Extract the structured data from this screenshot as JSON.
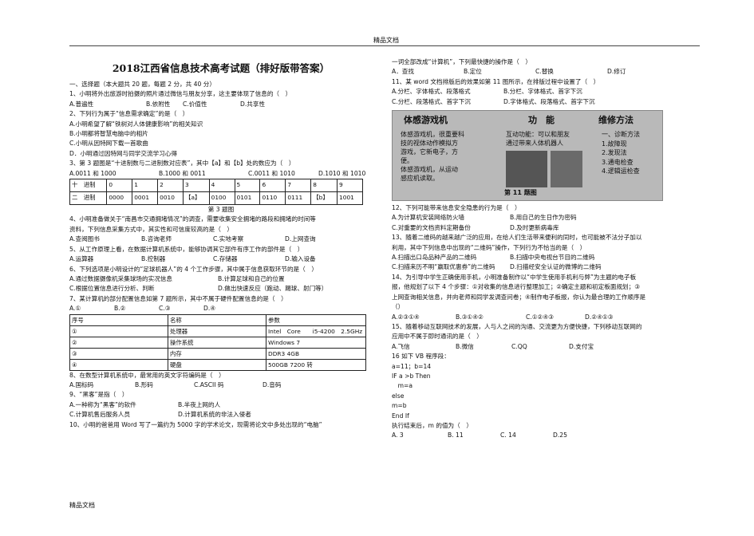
{
  "header": "精品文档",
  "footer": "精品文档",
  "title": "2018江西省信息技术高考试题（排好版带答案）",
  "section1": "一、选择题（本大题共 20 题，每题 2 分，共 40 分）",
  "q1": {
    "stem": "1、小明将外出旅游时拍摄的照片通过微信与朋友分享，这主要体现了信息的（　）",
    "a": "A.普遍性",
    "b": "B.依附性",
    "c": "C.价值性",
    "d": "D.共享性"
  },
  "q2": {
    "stem": "2、下列行为属于“信息需求确定”的是（　）",
    "a": "A.小明希望了解“铁树对人体健康影响”的相关知识",
    "b": "B.小明都将智慧电脑中的相片",
    "c": "C.小明从因特网下载一首歌曲",
    "d": "D．小明通过因特网与同学交流学习心得"
  },
  "q3": {
    "stem": "3、第 3 题图是“十进制数与二进制数对应表”，其中【a】和【b】处的数应为（　）",
    "a": "A.0011 和 1000",
    "b": "B.1000 和 0011",
    "c": "C.0011 和 1010",
    "d": "D.1010 和 1010",
    "row1": [
      "十　进制",
      "0",
      "1",
      "2",
      "3",
      "4",
      "5",
      "6",
      "7",
      "8",
      "9"
    ],
    "row2": [
      "二　进制",
      "0000",
      "0001",
      "0010",
      "【a】",
      "0100",
      "0101",
      "0110",
      "0111",
      "【b】",
      "1001"
    ],
    "caption": "第 3 题图"
  },
  "q4": {
    "stem1": "4、小明准备做关于“南昌市交通拥堵情况”的调查，需要收集安全拥堵的路段和拥堵的时间等",
    "stem2": "资料，下列信息采集方式中，其实性和可信度较高的是（　）",
    "a": "A.查阅图书",
    "b": "B.咨询老师",
    "c": "C.实地考察",
    "d": "D.上网查询"
  },
  "q5": {
    "stem": "5、从工作原理上看，在数据计算机系统中，能够协调其它部件有序工作的部件是（　）",
    "a": "A.运算器",
    "b": "B.控制器",
    "c": "C.存储器",
    "d": "D.输入设备"
  },
  "q6": {
    "stem": "6、下列选项是小明设计的“足球机器人”的 4 个工作步骤，其中属于信息获取环节的是（　）",
    "a": "A.通过数据摄像机采集球场的实况信息",
    "b": "B.计算足球和自己的位置",
    "c": "C.根据位置信息进行分析、判断",
    "d": "D.做出快速反应（跑动、踢球、射门等）"
  },
  "q7": {
    "stem": "7、某计算机的部分配置信息如第 7 题所示，其中不属于硬件配置信息的是（　）",
    "a": "A.①",
    "b": "B.②",
    "c": "C.③",
    "d": "D.④",
    "headers": [
      "序号",
      "名称",
      "参数"
    ],
    "rows": [
      [
        "①",
        "处理器",
        "Intel　Core　　i5-4200　2.5GHz"
      ],
      [
        "②",
        "操作系统",
        "Windows 7"
      ],
      [
        "③",
        "内存",
        "DDR3 4GB"
      ],
      [
        "④",
        "硬盘",
        "500GB 7200 转"
      ]
    ]
  },
  "q8": {
    "stem": "8、在数型计算机系统中，最常用的英文字符编码是（　）",
    "a": "A.国标码",
    "b": "B.形码",
    "c": "C.ASCII 码",
    "d": "D.音码"
  },
  "q9": {
    "stem": "9、“黑客”是指（　）",
    "a": "A.一种称为“黑客”的软件",
    "b": "B.半夜上网的人",
    "c": "C.计算机售后服务人员",
    "d": "D.计算机系统的非法入侵者"
  },
  "q10": {
    "stem": "10、小明的爸爸用 Word 写了一篇约为 5000 字的学术论文，现需将论文中多处出现的“电脑”"
  },
  "q10b": {
    "stem": "一词全部改成“计算机”，下列最快捷的操作是（　）",
    "a": "A．查找",
    "b": "B.定位",
    "c": "C.替换",
    "d": "D.修订"
  },
  "q11": {
    "stem": "11、某 word 文档排版后的效果如第 11 图所示，在排版过程中设置了（　）",
    "a": "A.分栏、字体格式、段落格式",
    "b": "B.分栏、字体格式、首字下沉",
    "c": "C.分栏、段落格式、首字下沉",
    "d": "D.字体格式、段落格式、首字下沉"
  },
  "figure11": {
    "title_left": "体感游戏机",
    "title_mid": "功　能",
    "title_right": "维修方法",
    "text_left": [
      "体感游戏机，很重要科",
      "技的视体动作模拟方",
      "游戏，它新电子，方",
      "便。",
      "体感游戏机，从运动",
      "感应机读取。"
    ],
    "text_mid": [
      "互动功能：可以和朋友",
      "通过带来人体机器人"
    ],
    "text_right": [
      "一、诊断方法",
      "1.故障现",
      "2.发现法",
      "3.通电检查",
      "4.逻辑运检查"
    ],
    "caption": "第 11 题图"
  },
  "q12": {
    "stem": "12、下列可能带来信息安全隐患的行为是（　）",
    "a": "A.为计算机安装网络防火墙",
    "b": "B.用自己的生日作为密码",
    "c": "C.对重要的文档资料定期备份",
    "d": "D.及时更新病毒库"
  },
  "q13": {
    "stem1": "13、随着二维码的越来越广泛的应用，在给人们生活带来便利的同时，也可能被不法分子加以",
    "stem2": "利用，其中下列信息中出现的“二维码”操作，下列行为不恰当的是（　）",
    "a": "A.扫描出口岛品种产品的二维码",
    "b": "B.扫描中央电视台节目的二维码",
    "c": "C.扫描来历不明“赢取优惠券”的二维码",
    "d": "D.扫描经安全认证的微博的二维码"
  },
  "q14": {
    "stem1": "14、为引导中学生正确使用手机，小明准备制作以“中学生使用手机利与弊”为主题的电子板",
    "stem2": "报，他规划了以下 4 个步骤：①对收集的信息进行整理加工；②确定主题和初定板面规划；③",
    "stem3": "上网查询相关信息，并向老师和同学发调查问卷；④制作电子板报，你认为最合理的工作顺序是",
    "stem4": "（）",
    "a": "A.②③①④",
    "b": "B.③①④②",
    "c": "C.①②④③",
    "d": "D.②④①③"
  },
  "q15": {
    "stem1": "15、随着移动互联网技术的发展，人与人之间的沟通、交流更为方便快捷，下列移动互联网的",
    "stem2": "应用中不属于即时通讯的是（　）",
    "a": "A.飞信",
    "b": "B.微信",
    "c": "C.QQ",
    "d": "D.支付宝"
  },
  "q16": {
    "stem": "16 如下 VB 程序段：",
    "code": [
      "a=11；b=14",
      "IF a >b Then",
      "　m=a",
      "else",
      "m=b",
      "End If",
      "执行结束后，m 的值为（　）"
    ],
    "a": "A. 3",
    "b": "B. 11",
    "c": "C. 14",
    "d": "D.25"
  }
}
